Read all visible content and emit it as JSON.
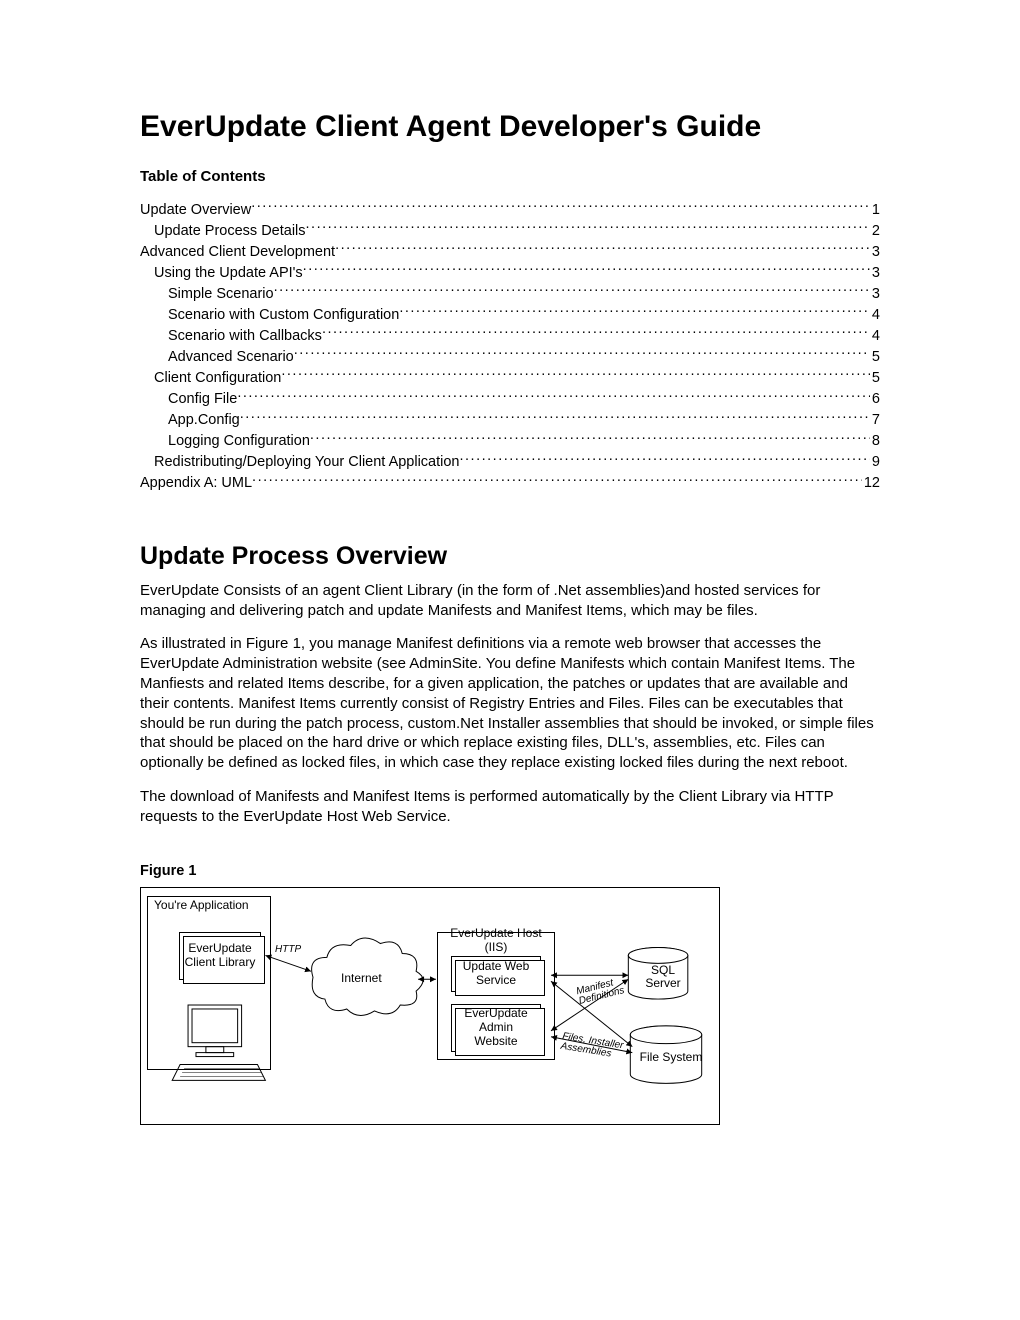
{
  "title": "EverUpdate Client Agent Developer's Guide",
  "toc_header": "Table of Contents",
  "toc": [
    {
      "label": "Update Overview",
      "page": "1",
      "level": 1
    },
    {
      "label": "Update Process Details",
      "page": "2",
      "level": 2
    },
    {
      "label": "Advanced Client Development",
      "page": "3",
      "level": 1
    },
    {
      "label": "Using the Update API's",
      "page": "3",
      "level": 2
    },
    {
      "label": "Simple Scenario",
      "page": "3",
      "level": 3
    },
    {
      "label": "Scenario with Custom Configuration",
      "page": "4",
      "level": 3
    },
    {
      "label": "Scenario with Callbacks",
      "page": "4",
      "level": 3
    },
    {
      "label": "Advanced Scenario",
      "page": "5",
      "level": 3
    },
    {
      "label": "Client Configuration",
      "page": "5",
      "level": 2
    },
    {
      "label": "Config File",
      "page": "6",
      "level": 3
    },
    {
      "label": "App.Config",
      "page": "7",
      "level": 3
    },
    {
      "label": "Logging Configuration",
      "page": "8",
      "level": 3
    },
    {
      "label": "Redistributing/Deploying Your Client Application",
      "page": "9",
      "level": 2
    },
    {
      "label": "Appendix A: UML",
      "page": "12",
      "level": 1
    }
  ],
  "section_title": "Update Process Overview",
  "para1": "EverUpdate Consists of an agent Client Library (in the form of .Net assemblies)and hosted services for managing and delivering patch and update Manifests and Manifest Items, which may be files.",
  "para2": "As illustrated in Figure 1, you manage Manifest definitions via a remote web browser that accesses the EverUpdate Administration website (see AdminSite.  You define Manifests which contain Manifest Items.  The Manfiests and related Items describe, for a given application, the patches or updates that are available and their contents.  Manifest Items currently consist of Registry Entries and Files.  Files can be executables that should be run during the patch process, custom.Net Installer assemblies that should be invoked, or simple files that should be placed on the hard drive or which replace existing files, DLL's, assemblies, etc.  Files can optionally be defined as locked files, in which case they replace existing locked files during the next reboot.",
  "para3": "The download of Manifests and Manifest Items is performed automatically by the Client Library via HTTP requests to the EverUpdate Host Web Service.",
  "figure_label": "Figure 1",
  "diagram": {
    "your_app": "You're Application",
    "client_lib": "EverUpdate Client Library",
    "http": "HTTP",
    "internet": "Internet",
    "host": "EverUpdate Host (IIS)",
    "web_service": "Update Web Service",
    "admin_site": "EverUpdate Admin Website",
    "manifest_def": "Manifest Definitions",
    "files_inst": "Files, Installer Assemblies",
    "sql": "SQL Server",
    "filesys": "File System"
  }
}
